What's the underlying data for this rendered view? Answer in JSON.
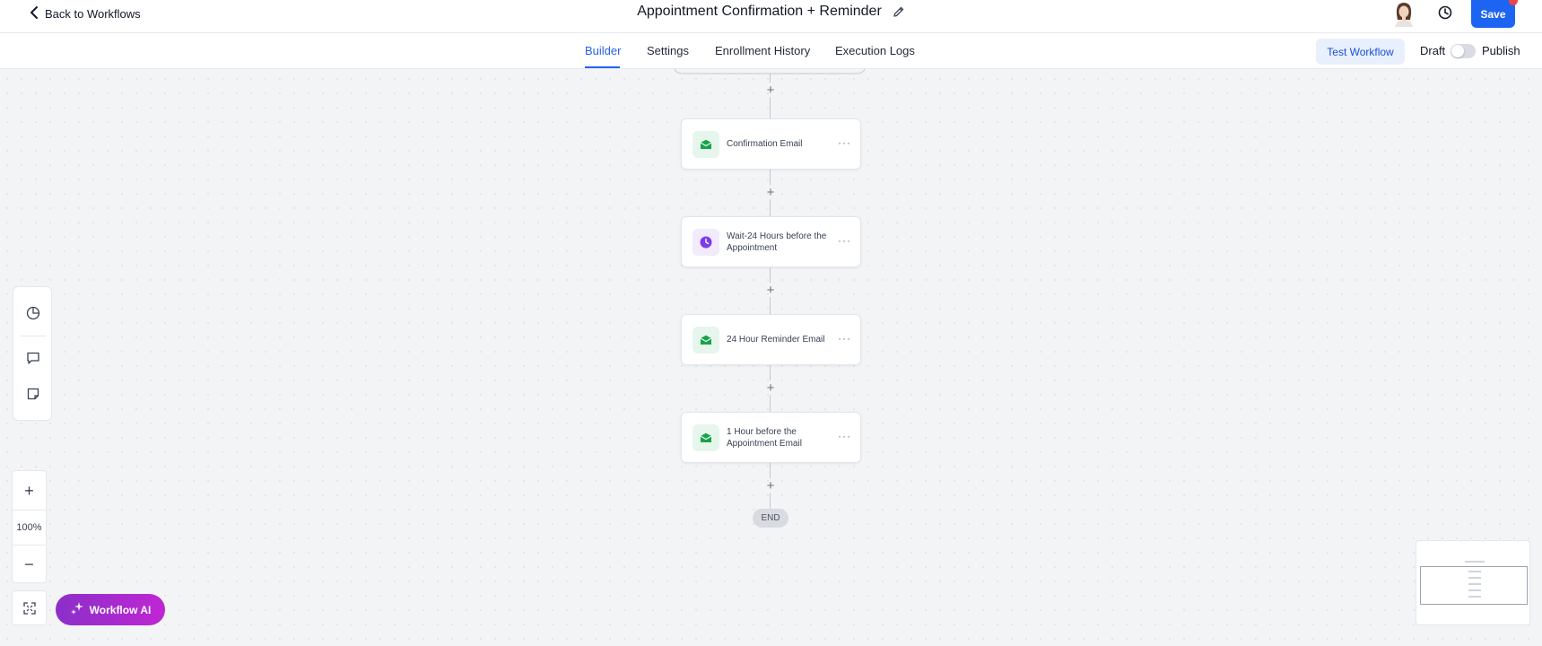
{
  "header": {
    "back_label": "Back to Workflows",
    "title": "Appointment Confirmation + Reminder",
    "save_label": "Save"
  },
  "tabs": [
    {
      "label": "Builder",
      "active": true
    },
    {
      "label": "Settings",
      "active": false
    },
    {
      "label": "Enrollment History",
      "active": false
    },
    {
      "label": "Execution Logs",
      "active": false
    }
  ],
  "actions": {
    "test_label": "Test Workflow",
    "draft_label": "Draft",
    "publish_label": "Publish",
    "published": false
  },
  "workflow": {
    "steps": [
      {
        "label": "Confirmation Email",
        "icon": "email-icon",
        "color": "#16a34a"
      },
      {
        "label": "Wait-24 Hours before the Appointment",
        "icon": "clock-icon",
        "color": "#7c3aed"
      },
      {
        "label": "24 Hour Reminder Email",
        "icon": "email-icon",
        "color": "#16a34a"
      },
      {
        "label": "1 Hour before the Appointment Email",
        "icon": "email-icon",
        "color": "#16a34a"
      }
    ],
    "end_label": "END"
  },
  "canvas_controls": {
    "zoom_label": "100%",
    "ai_label": "Workflow AI"
  },
  "colors": {
    "accent": "#2563eb",
    "save_button": "#1d64f2",
    "email_icon": "#16a34a",
    "wait_icon": "#7c3aed",
    "ai_gradient_start": "#8b2fc9",
    "ai_gradient_end": "#c026d3"
  }
}
